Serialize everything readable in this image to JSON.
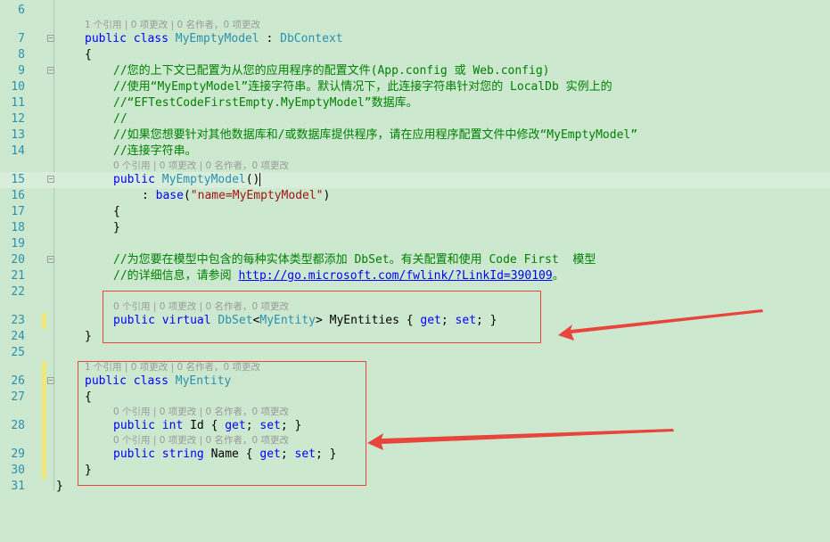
{
  "editor": {
    "rows": [
      {
        "type": "code",
        "num": "6",
        "indent": 0,
        "tokens": []
      },
      {
        "type": "lens",
        "indent": 1,
        "text": "1 个引用 | 0 项更改 | 0 名作者，0 项更改"
      },
      {
        "type": "code",
        "num": "7",
        "indent": 1,
        "fold": true,
        "tokens": [
          {
            "t": "public class ",
            "c": "kw"
          },
          {
            "t": "MyEmptyModel",
            "c": "ty"
          },
          {
            "t": " : ",
            "c": "pl"
          },
          {
            "t": "DbContext",
            "c": "ty"
          }
        ]
      },
      {
        "type": "code",
        "num": "8",
        "indent": 1,
        "tokens": [
          {
            "t": "{",
            "c": "pl"
          }
        ]
      },
      {
        "type": "code",
        "num": "9",
        "indent": 2,
        "fold": true,
        "tokens": [
          {
            "t": "//您的上下文已配置为从您的应用程序的配置文件(App.config 或 Web.config)",
            "c": "cm"
          }
        ]
      },
      {
        "type": "code",
        "num": "10",
        "indent": 2,
        "tokens": [
          {
            "t": "//使用“MyEmptyModel”连接字符串。默认情况下，此连接字符串针对您的 LocalDb 实例上的",
            "c": "cm"
          }
        ]
      },
      {
        "type": "code",
        "num": "11",
        "indent": 2,
        "tokens": [
          {
            "t": "//“EFTestCodeFirstEmpty.MyEmptyModel”数据库。",
            "c": "cm"
          }
        ]
      },
      {
        "type": "code",
        "num": "12",
        "indent": 2,
        "tokens": [
          {
            "t": "//",
            "c": "cm"
          }
        ]
      },
      {
        "type": "code",
        "num": "13",
        "indent": 2,
        "tokens": [
          {
            "t": "//如果您想要针对其他数据库和/或数据库提供程序，请在应用程序配置文件中修改“MyEmptyModel”",
            "c": "cm"
          }
        ]
      },
      {
        "type": "code",
        "num": "14",
        "indent": 2,
        "tokens": [
          {
            "t": "//连接字符串。",
            "c": "cm"
          }
        ]
      },
      {
        "type": "lens",
        "indent": 2,
        "text": "0 个引用 | 0 项更改 | 0 名作者，0 项更改"
      },
      {
        "type": "code",
        "num": "15",
        "indent": 2,
        "fold": true,
        "current": true,
        "tokens": [
          {
            "t": "public ",
            "c": "kw"
          },
          {
            "t": "MyEmptyModel",
            "c": "ty"
          },
          {
            "t": "()",
            "c": "pl"
          }
        ]
      },
      {
        "type": "code",
        "num": "16",
        "indent": 3,
        "tokens": [
          {
            "t": ": ",
            "c": "pl"
          },
          {
            "t": "base",
            "c": "kw"
          },
          {
            "t": "(",
            "c": "pl"
          },
          {
            "t": "\"name=MyEmptyModel\"",
            "c": "st"
          },
          {
            "t": ")",
            "c": "pl"
          }
        ]
      },
      {
        "type": "code",
        "num": "17",
        "indent": 2,
        "tokens": [
          {
            "t": "{",
            "c": "pl"
          }
        ]
      },
      {
        "type": "code",
        "num": "18",
        "indent": 2,
        "tokens": [
          {
            "t": "}",
            "c": "pl"
          }
        ]
      },
      {
        "type": "code",
        "num": "19",
        "indent": 2,
        "tokens": []
      },
      {
        "type": "code",
        "num": "20",
        "indent": 2,
        "fold": true,
        "tokens": [
          {
            "t": "//为您要在模型中包含的每种实体类型都添加 DbSet。有关配置和使用 Code First  模型",
            "c": "cm"
          }
        ]
      },
      {
        "type": "code",
        "num": "21",
        "indent": 2,
        "tokens": [
          {
            "t": "//的详细信息，请参阅 ",
            "c": "cm"
          },
          {
            "t": "http://go.microsoft.com/fwlink/?LinkId=390109",
            "c": "ln"
          },
          {
            "t": "。",
            "c": "cm"
          }
        ]
      },
      {
        "type": "code",
        "num": "22",
        "indent": 2,
        "tokens": []
      },
      {
        "type": "lens",
        "indent": 2,
        "text": "0 个引用 | 0 项更改 | 0 名作者，0 项更改"
      },
      {
        "type": "code",
        "num": "23",
        "indent": 2,
        "changed": true,
        "tokens": [
          {
            "t": "public virtual ",
            "c": "kw"
          },
          {
            "t": "DbSet",
            "c": "ty"
          },
          {
            "t": "<",
            "c": "pl"
          },
          {
            "t": "MyEntity",
            "c": "ty"
          },
          {
            "t": "> MyEntities { ",
            "c": "pl"
          },
          {
            "t": "get",
            "c": "kw"
          },
          {
            "t": "; ",
            "c": "pl"
          },
          {
            "t": "set",
            "c": "kw"
          },
          {
            "t": "; }",
            "c": "pl"
          }
        ]
      },
      {
        "type": "code",
        "num": "24",
        "indent": 1,
        "tokens": [
          {
            "t": "}",
            "c": "pl"
          }
        ]
      },
      {
        "type": "code",
        "num": "25",
        "indent": 1,
        "tokens": []
      },
      {
        "type": "lens",
        "indent": 1,
        "changed": true,
        "text": "1 个引用 | 0 项更改 | 0 名作者，0 项更改"
      },
      {
        "type": "code",
        "num": "26",
        "indent": 1,
        "fold": true,
        "changed": true,
        "tokens": [
          {
            "t": "public class ",
            "c": "kw"
          },
          {
            "t": "MyEntity",
            "c": "ty"
          }
        ]
      },
      {
        "type": "code",
        "num": "27",
        "indent": 1,
        "changed": true,
        "tokens": [
          {
            "t": "{",
            "c": "pl"
          }
        ]
      },
      {
        "type": "lens",
        "indent": 2,
        "changed": true,
        "text": "0 个引用 | 0 项更改 | 0 名作者，0 项更改"
      },
      {
        "type": "code",
        "num": "28",
        "indent": 2,
        "changed": true,
        "tokens": [
          {
            "t": "public int ",
            "c": "kw"
          },
          {
            "t": "Id { ",
            "c": "pl"
          },
          {
            "t": "get",
            "c": "kw"
          },
          {
            "t": "; ",
            "c": "pl"
          },
          {
            "t": "set",
            "c": "kw"
          },
          {
            "t": "; }",
            "c": "pl"
          }
        ]
      },
      {
        "type": "lens",
        "indent": 2,
        "changed": true,
        "text": "0 个引用 | 0 项更改 | 0 名作者，0 项更改"
      },
      {
        "type": "code",
        "num": "29",
        "indent": 2,
        "changed": true,
        "tokens": [
          {
            "t": "public string ",
            "c": "kw"
          },
          {
            "t": "Name { ",
            "c": "pl"
          },
          {
            "t": "get",
            "c": "kw"
          },
          {
            "t": "; ",
            "c": "pl"
          },
          {
            "t": "set",
            "c": "kw"
          },
          {
            "t": "; }",
            "c": "pl"
          }
        ]
      },
      {
        "type": "code",
        "num": "30",
        "indent": 1,
        "changed": true,
        "tokens": [
          {
            "t": "}",
            "c": "pl"
          }
        ]
      },
      {
        "type": "code",
        "num": "31",
        "indent": 0,
        "tokens": [
          {
            "t": "}",
            "c": "pl"
          }
        ]
      }
    ]
  },
  "colors": {
    "background": "#cce8cf",
    "keyword": "#0000ff",
    "type": "#2b91af",
    "comment": "#008000",
    "string": "#a31515",
    "annotation": "#e8453c",
    "change_bar": "#efe779"
  }
}
